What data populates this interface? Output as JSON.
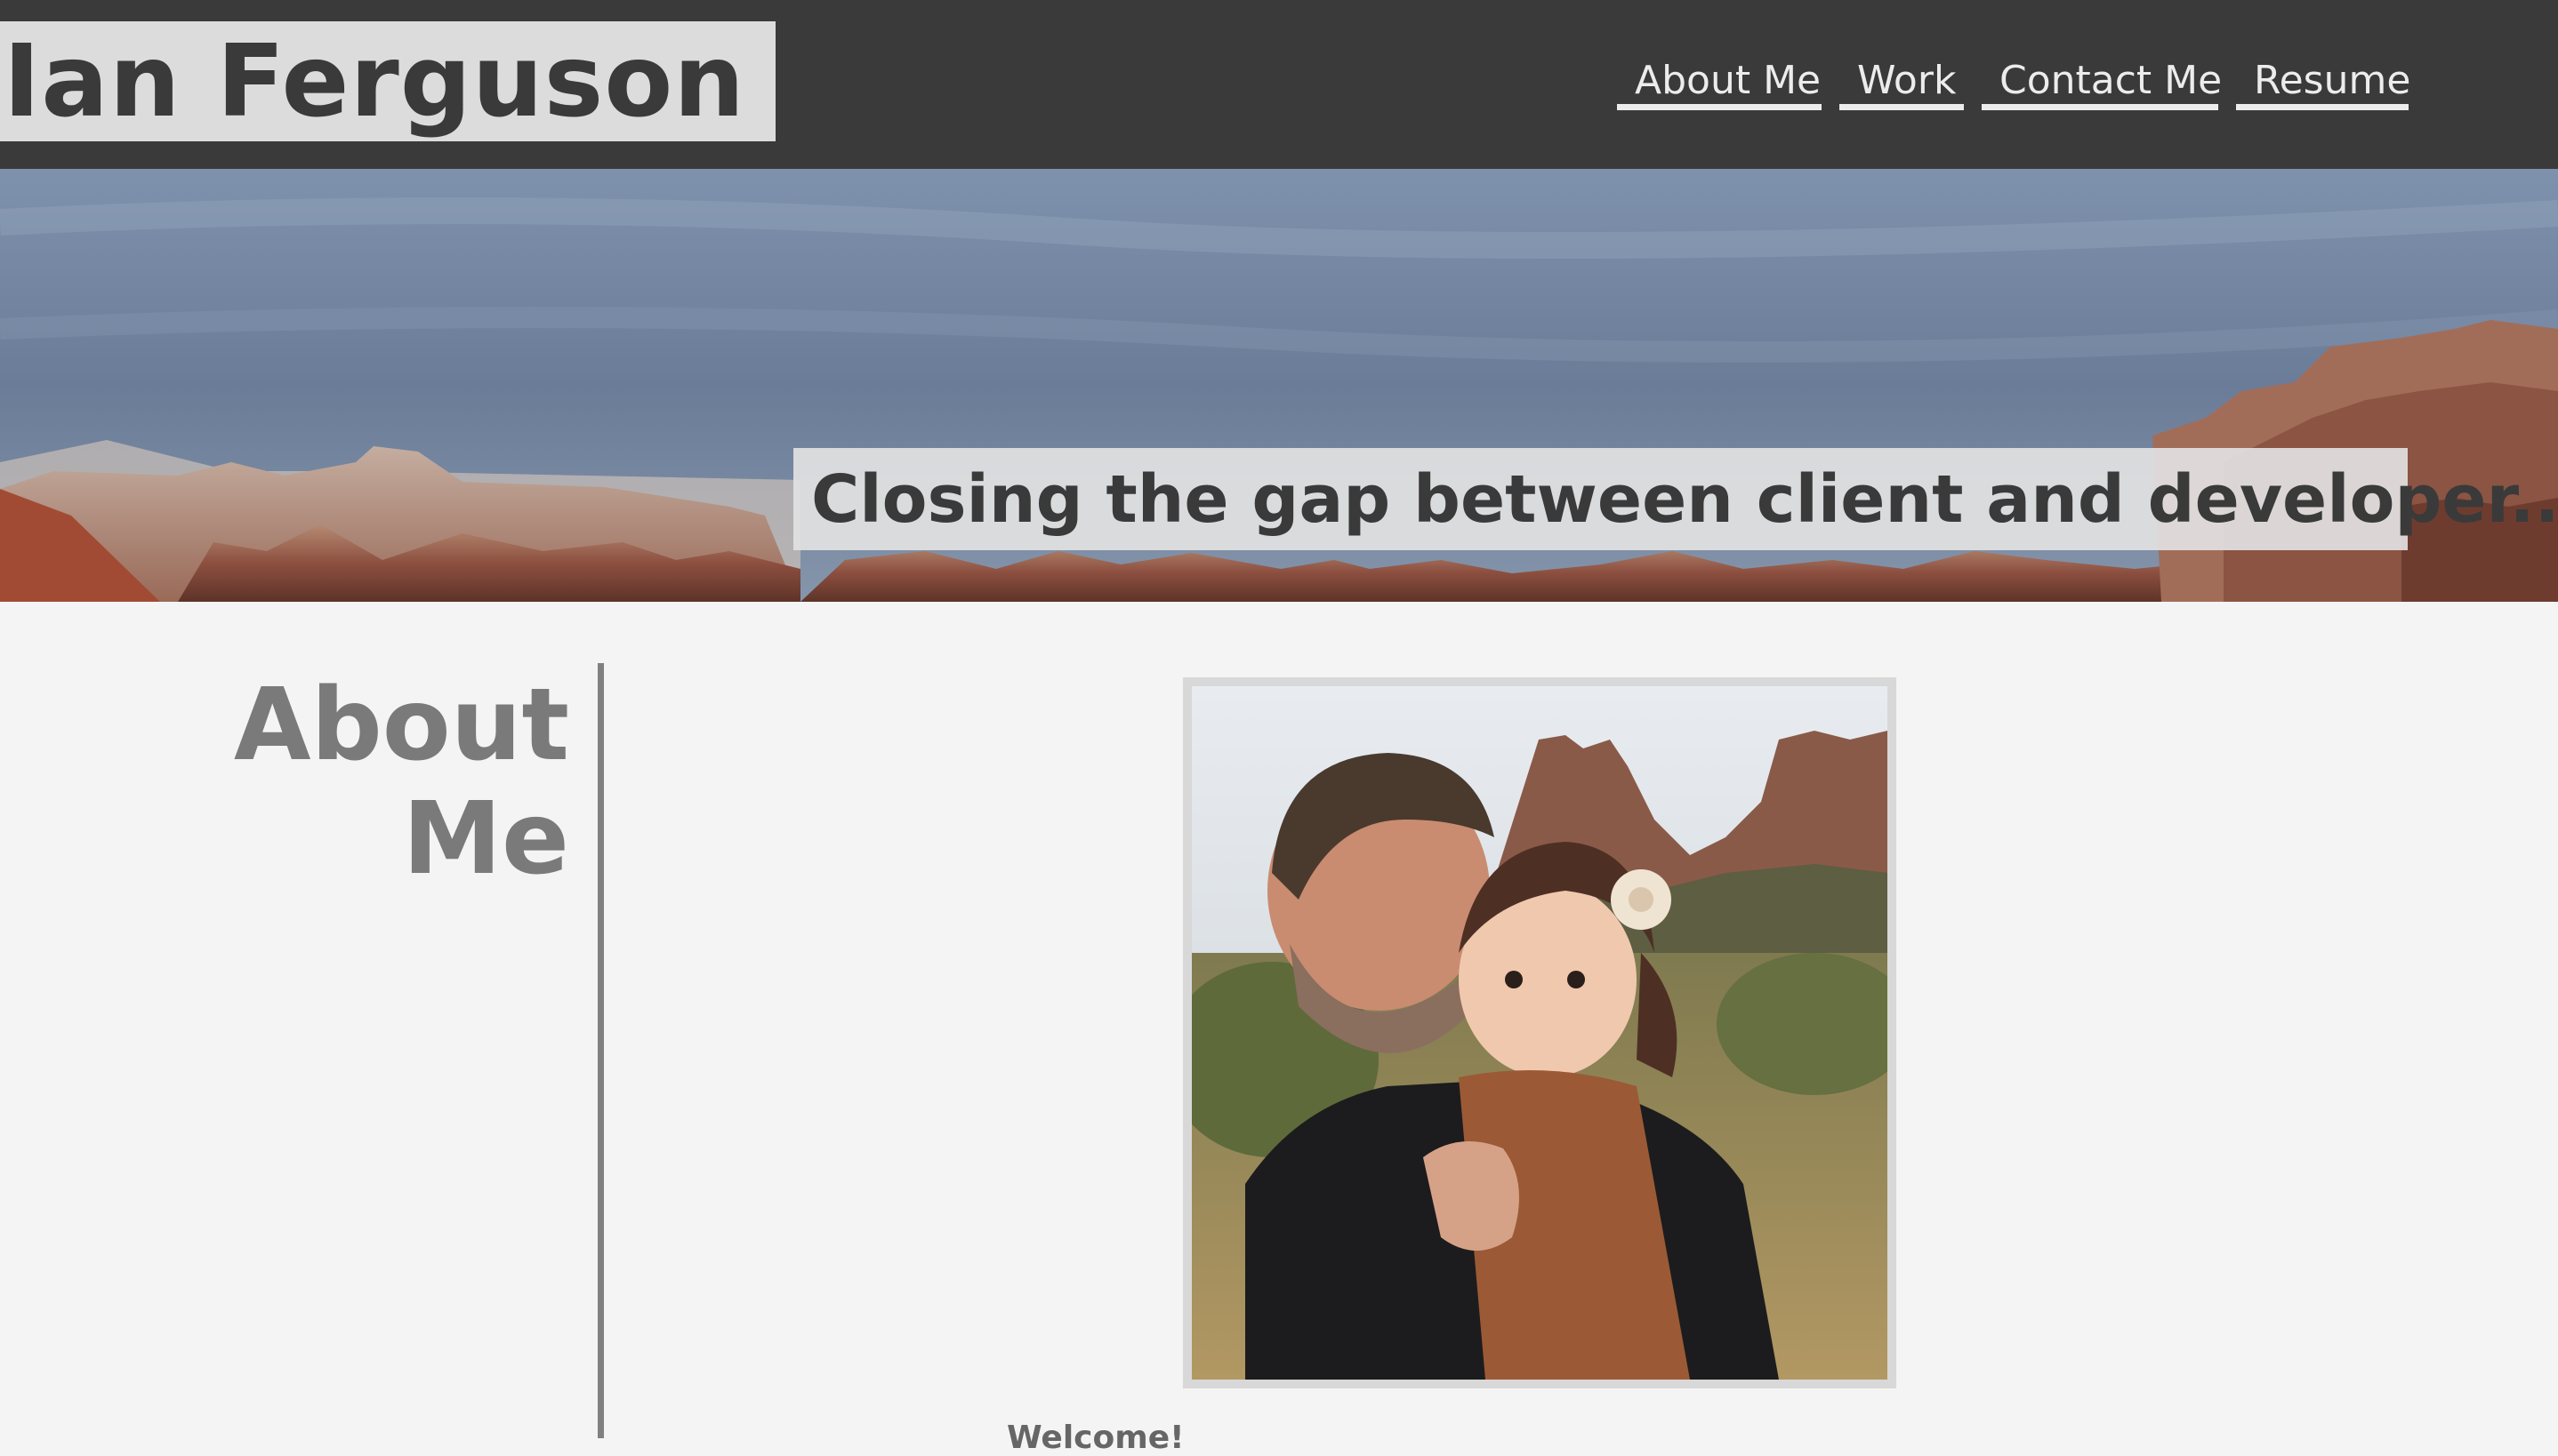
{
  "header": {
    "site_name": "Ian Ferguson",
    "nav": [
      {
        "label": "About Me"
      },
      {
        "label": "Work"
      },
      {
        "label": "Contact Me"
      },
      {
        "label": "Resume"
      }
    ]
  },
  "hero": {
    "tagline": "Closing the gap between client and developer..."
  },
  "about": {
    "title": "About Me",
    "welcome": "Welcome!"
  },
  "colors": {
    "header_bg": "#3a3a3a",
    "page_bg": "#f4f4f4",
    "title_gray": "#7a7a7a",
    "nav_text": "#ececec"
  }
}
